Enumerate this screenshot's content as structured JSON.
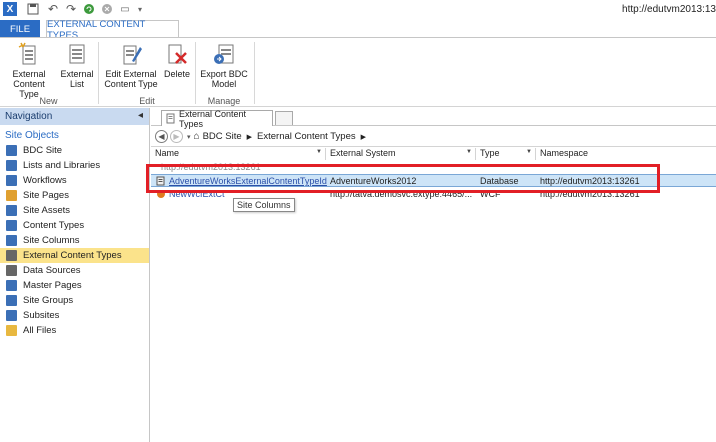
{
  "window": {
    "url": "http://edutvm2013:13"
  },
  "ribbon": {
    "tabs": {
      "file": "FILE",
      "active": "EXTERNAL CONTENT TYPES"
    },
    "groups": {
      "new": {
        "label": "New",
        "buttons": [
          "External\nContent Type",
          "External\nList"
        ]
      },
      "edit": {
        "label": "Edit",
        "buttons": [
          "Edit External\nContent Type",
          "Delete"
        ]
      },
      "manage": {
        "label": "Manage",
        "buttons": [
          "Export BDC\nModel"
        ]
      }
    }
  },
  "nav": {
    "header": "Navigation",
    "section": "Site Objects",
    "items": [
      {
        "label": "BDC Site",
        "icon": "site-icon",
        "color": "#3b6fb6"
      },
      {
        "label": "Lists and Libraries",
        "icon": "list-icon",
        "color": "#3b6fb6"
      },
      {
        "label": "Workflows",
        "icon": "workflow-icon",
        "color": "#3b6fb6"
      },
      {
        "label": "Site Pages",
        "icon": "page-icon",
        "color": "#e0a030"
      },
      {
        "label": "Site Assets",
        "icon": "assets-icon",
        "color": "#3b6fb6"
      },
      {
        "label": "Content Types",
        "icon": "content-type-icon",
        "color": "#3b6fb6"
      },
      {
        "label": "Site Columns",
        "icon": "column-icon",
        "color": "#3b6fb6"
      },
      {
        "label": "External Content Types",
        "icon": "ect-icon",
        "color": "#666666"
      },
      {
        "label": "Data Sources",
        "icon": "datasource-icon",
        "color": "#666666"
      },
      {
        "label": "Master Pages",
        "icon": "masterpage-icon",
        "color": "#3b6fb6"
      },
      {
        "label": "Site Groups",
        "icon": "group-icon",
        "color": "#3b6fb6"
      },
      {
        "label": "Subsites",
        "icon": "subsite-icon",
        "color": "#3b6fb6"
      },
      {
        "label": "All Files",
        "icon": "folder-icon",
        "color": "#e8b840"
      }
    ],
    "selected_index": 7
  },
  "main": {
    "tab_label": "External Content Types",
    "breadcrumb": [
      "BDC Site",
      "External Content Types"
    ],
    "columns": [
      "Name",
      "External System",
      "Type",
      "Namespace"
    ],
    "group_row": "http://edutvm2013:13261",
    "rows": [
      {
        "name": "AdventureWorksExternalContentTypeId",
        "system": "AdventureWorks2012",
        "type": "Database",
        "namespace": "http://edutvm2013:13261",
        "selected": true
      },
      {
        "name": "NewWcfExtCt",
        "system": "http://tatva.demosvc.extype:4465/...",
        "type": "WCF",
        "namespace": "http://edutvm2013:13261",
        "selected": false
      }
    ],
    "tooltip": "Site Columns"
  }
}
